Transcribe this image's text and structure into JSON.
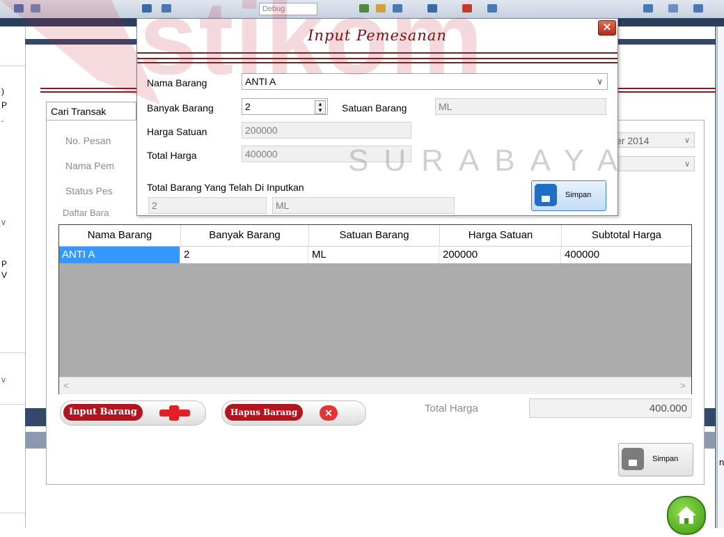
{
  "toolbar": {
    "config_dropdown": "Debug"
  },
  "stub": {
    "chars": [
      ")",
      "P",
      ".",
      "v",
      "P",
      "V",
      "v"
    ]
  },
  "background_form": {
    "tab_label": "Cari Transak",
    "labels": {
      "no_pesanan": "No. Pesan",
      "nama_pemesan": "Nama Pem",
      "status_pesanan": "Status Pes",
      "daftar_barang": "Daftar Bara"
    },
    "date_value": "er 2014",
    "right_edge_char": "n",
    "grid": {
      "columns": [
        "Nama Barang",
        "Banyak Barang",
        "Satuan Barang",
        "Harga Satuan",
        "Subtotal Harga"
      ],
      "rows": [
        [
          "ANTI A",
          "2",
          "ML",
          "200000",
          "400000"
        ]
      ]
    },
    "input_barang_label": "Input Barang",
    "hapus_barang_label": "Hapus Barang",
    "total_harga_label": "Total Harga",
    "total_harga_value": "400.000",
    "simpan_label": "Simpan"
  },
  "dialog": {
    "title": "Input Pemesanan",
    "close_glyph": "✕",
    "nama_barang_label": "Nama Barang",
    "nama_barang_value": "ANTI A",
    "banyak_barang_label": "Banyak Barang",
    "banyak_barang_value": "2",
    "satuan_barang_label": "Satuan Barang",
    "satuan_barang_value": "ML",
    "harga_satuan_label": "Harga Satuan",
    "harga_satuan_value": "200000",
    "total_harga_label": "Total Harga",
    "total_harga_value": "400000",
    "total_inputkan_label": "Total Barang Yang Telah Di Inputkan",
    "total_inputkan_qty": "2",
    "total_inputkan_unit": "ML",
    "simpan_label": "Simpan"
  },
  "watermark": {
    "brand": "stikom",
    "city": "SURABAYA"
  },
  "colors": {
    "accent_red": "#8b1a1a",
    "selection_blue": "#3399ff",
    "navy": "#34486a",
    "home_green": "#3f9a12"
  }
}
